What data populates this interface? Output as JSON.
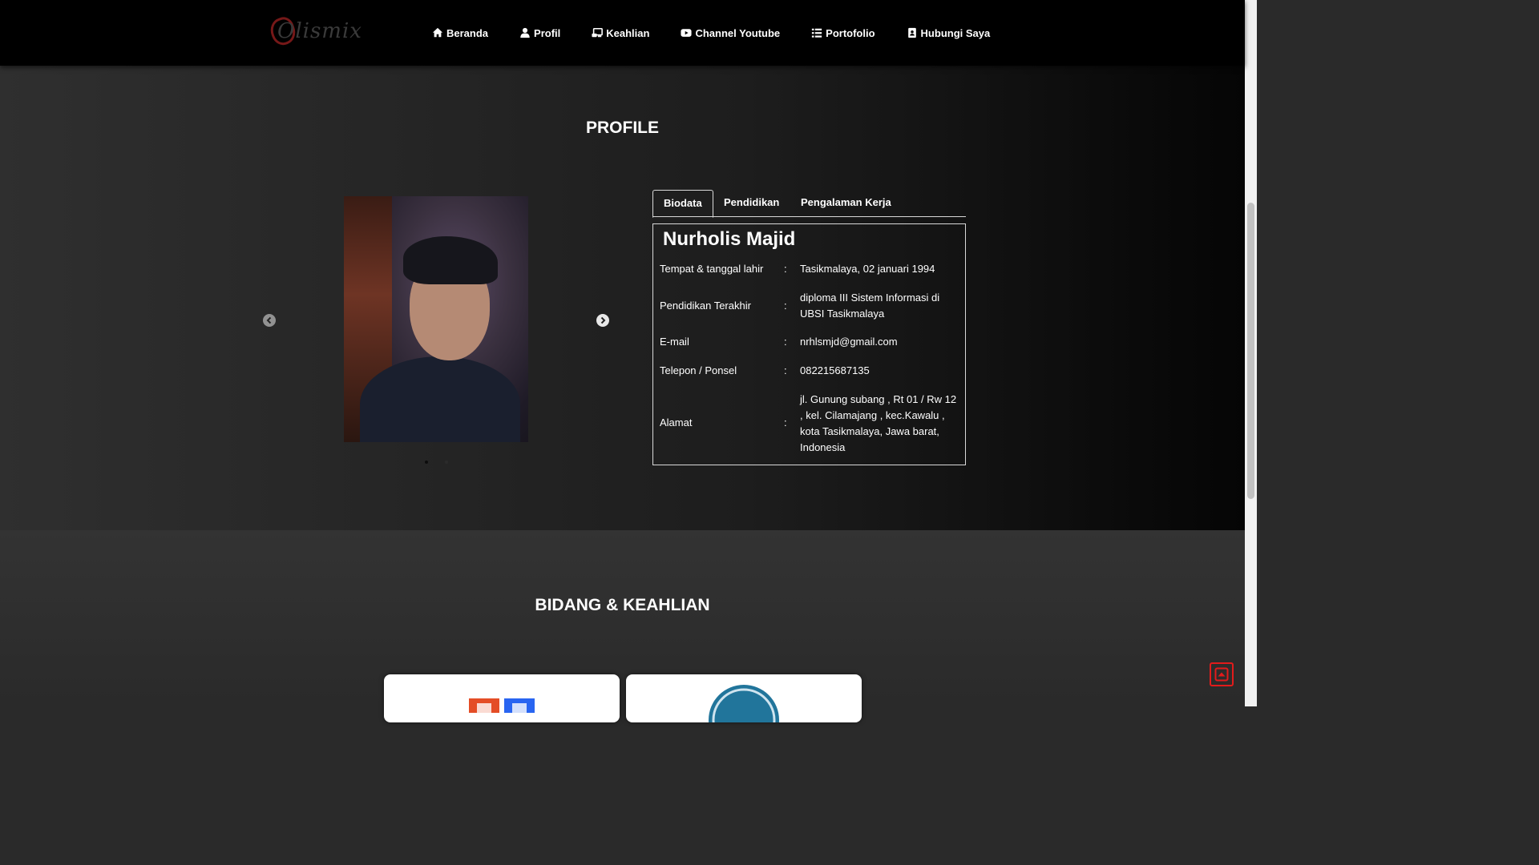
{
  "brand": {
    "logo_text": "Olismix"
  },
  "nav": {
    "items": [
      {
        "label": "Beranda",
        "icon": "home-icon"
      },
      {
        "label": "Profil",
        "icon": "user-icon"
      },
      {
        "label": "Keahlian",
        "icon": "music-icon"
      },
      {
        "label": "Channel Youtube",
        "icon": "youtube-icon"
      },
      {
        "label": "Portofolio",
        "icon": "list-icon"
      },
      {
        "label": "Hubungi Saya",
        "icon": "contact-book-icon"
      }
    ]
  },
  "profile": {
    "title": "PROFILE",
    "tabs": [
      "Biodata",
      "Pendidikan",
      "Pengalaman Kerja"
    ],
    "active_tab": "Biodata",
    "name": "Nurholis Majid",
    "rows": [
      {
        "label": "Tempat & tanggal lahir",
        "value": "Tasikmalaya, 02 januari 1994"
      },
      {
        "label": "Pendidikan Terakhir",
        "value": "diploma III Sistem Informasi di UBSI Tasikmalaya"
      },
      {
        "label": "E-mail",
        "value": "nrhlsmjd@gmail.com"
      },
      {
        "label": "Telepon / Ponsel",
        "value": "082215687135"
      },
      {
        "label": "Alamat",
        "value": "jl. Gunung subang , Rt 01 / Rw 12 , kel. Cilamajang , kec.Kawalu , kota Tasikmalaya, Jawa barat, Indonesia"
      }
    ],
    "separator": ":"
  },
  "skills": {
    "title": "BIDANG & KEAHLIAN"
  },
  "colors": {
    "accent": "#e21b1b",
    "nav_bg": "#000000"
  }
}
